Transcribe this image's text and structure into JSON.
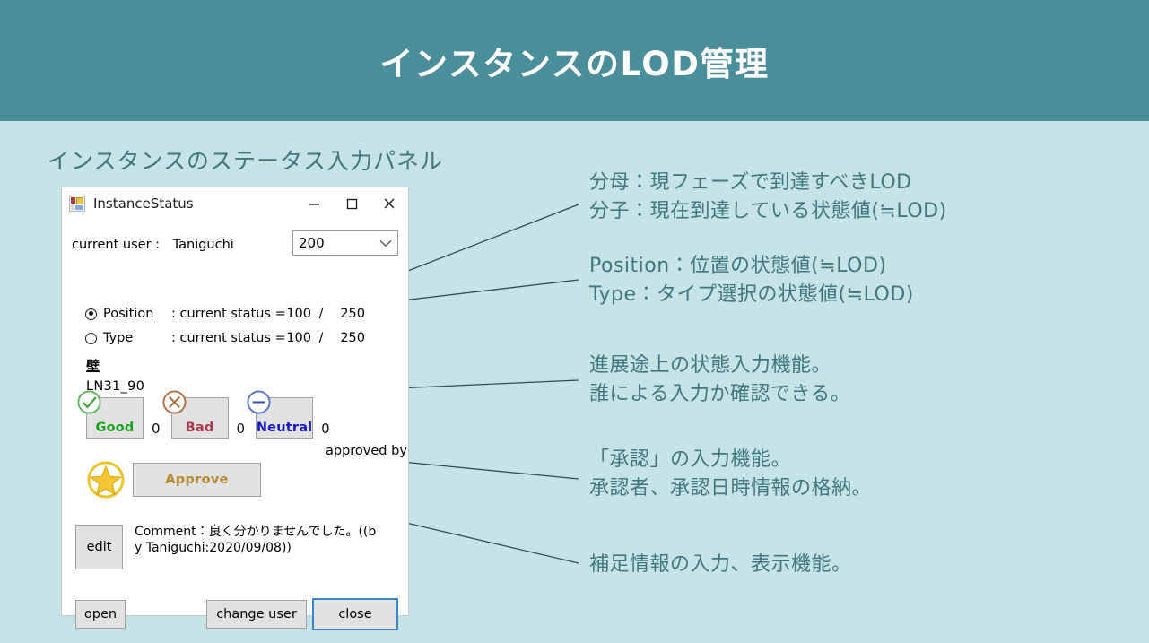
{
  "header": {
    "title": "インスタンスのLOD管理",
    "background_color": "#4a8d9b",
    "title_color": "#ffffff"
  },
  "page": {
    "background_color": "#c5e4e7",
    "subtitle": "インスタンスのステータス入力パネル",
    "accent_color": "#3f7680"
  },
  "dialog": {
    "title": "InstanceStatus",
    "app_icon": "winforms-app-icon",
    "titlebar_buttons": [
      {
        "name": "minimize",
        "icon": "minimize-icon"
      },
      {
        "name": "maximize",
        "icon": "maximize-icon"
      },
      {
        "name": "close",
        "icon": "close-icon"
      }
    ],
    "current_user": {
      "label": "current user :",
      "value": "Taniguchi"
    },
    "lod_combobox": {
      "value": "200",
      "icon": "chevron-down-icon",
      "options": [
        "200"
      ]
    },
    "status_rows": [
      {
        "id": "position",
        "label": "Position",
        "text": ": current status =",
        "numerator": "100",
        "separator": "/",
        "denominator": "250",
        "selected": true
      },
      {
        "id": "type",
        "label": "Type",
        "text": ": current status =",
        "numerator": "100",
        "separator": "/",
        "denominator": "250",
        "selected": false
      }
    ],
    "element": {
      "category": "壁",
      "identifier": "LN31_90"
    },
    "votes": [
      {
        "id": "good",
        "label": "Good",
        "count": "0",
        "icon": "check-circle-icon",
        "color": "#18a318"
      },
      {
        "id": "bad",
        "label": "Bad",
        "count": "0",
        "icon": "x-circle-icon",
        "color": "#b2324a"
      },
      {
        "id": "neutral",
        "label": "Neutral",
        "count": "0",
        "icon": "minus-circle-icon",
        "color": "#1414c8"
      }
    ],
    "approve": {
      "star_icon": "star-icon",
      "button_label": "Approve",
      "approved_by_label": "approved by",
      "approved_by_value": ""
    },
    "comment": {
      "edit_button_label": "edit",
      "text": "Comment：良く分かりませんでした。((by Taniguchi:2020/09/08))"
    },
    "footer_buttons": [
      {
        "id": "open",
        "label": "open"
      },
      {
        "id": "change-user",
        "label": "change user"
      },
      {
        "id": "close",
        "label": "close",
        "focused": true
      }
    ]
  },
  "annotations": [
    {
      "id": "lod-fraction",
      "line1": "分母：現フェーズで到達すべきLOD",
      "line2": "分子：現在到達している状態値(≒LOD)"
    },
    {
      "id": "position-type",
      "line1": "Position：位置の状態値(≒LOD)",
      "line2": "Type：タイプ選択の状態値(≒LOD)"
    },
    {
      "id": "progress-input",
      "line1": "進展途上の状態入力機能。",
      "line2": "誰による入力か確認できる。"
    },
    {
      "id": "approval-input",
      "line1": "「承認」の入力機能。",
      "line2": "承認者、承認日時情報の格納。"
    },
    {
      "id": "supplementary-info",
      "line1": "補足情報の入力、表示機能。",
      "line2": ""
    }
  ],
  "leaders": {
    "dot_color": "#2e6b73",
    "line_color": "#2b4f55"
  }
}
